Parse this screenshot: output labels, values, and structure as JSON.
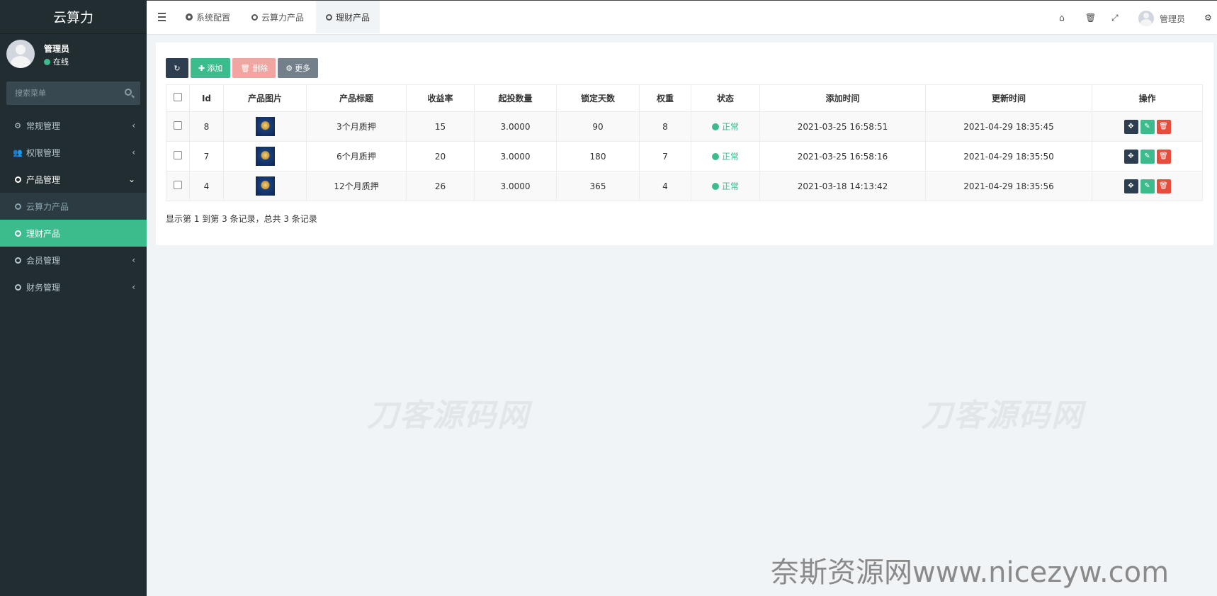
{
  "app": {
    "title": "云算力"
  },
  "user": {
    "name": "管理员",
    "status": "在线"
  },
  "search": {
    "placeholder": "搜索菜单"
  },
  "menu": [
    {
      "label": "常规管理"
    },
    {
      "label": "权限管理"
    },
    {
      "label": "产品管理"
    },
    {
      "label": "云算力产品"
    },
    {
      "label": "理财产品"
    },
    {
      "label": "会员管理"
    },
    {
      "label": "财务管理"
    }
  ],
  "tabs": [
    {
      "label": "系统配置"
    },
    {
      "label": "云算力产品"
    },
    {
      "label": "理财产品"
    }
  ],
  "topbar": {
    "user": "管理员"
  },
  "toolbar": {
    "add": "添加",
    "delete": "删除",
    "more": "更多"
  },
  "table": {
    "headers": [
      "Id",
      "产品图片",
      "产品标题",
      "收益率",
      "起投数量",
      "锁定天数",
      "权重",
      "状态",
      "添加时间",
      "更新时间",
      "操作"
    ],
    "rows": [
      {
        "id": "8",
        "title": "3个月质押",
        "rate": "15",
        "min": "3.0000",
        "days": "90",
        "weight": "8",
        "status": "正常",
        "created": "2021-03-25 16:58:51",
        "updated": "2021-04-29 18:35:45"
      },
      {
        "id": "7",
        "title": "6个月质押",
        "rate": "20",
        "min": "3.0000",
        "days": "180",
        "weight": "7",
        "status": "正常",
        "created": "2021-03-25 16:58:16",
        "updated": "2021-04-29 18:35:50"
      },
      {
        "id": "4",
        "title": "12个月质押",
        "rate": "26",
        "min": "3.0000",
        "days": "365",
        "weight": "4",
        "status": "正常",
        "created": "2021-03-18 14:13:42",
        "updated": "2021-04-29 18:35:56"
      }
    ]
  },
  "pager": {
    "text": "显示第 1 到第 3 条记录，总共 3 条记录"
  },
  "watermarks": {
    "center": "刀客源码网",
    "bottom": "奈斯资源网www.nicezyw.com"
  },
  "colors": {
    "sidebar": "#222d32",
    "accent": "#3cbc8d",
    "danger": "#e74c3c",
    "dark_button": "#2c3e50"
  }
}
